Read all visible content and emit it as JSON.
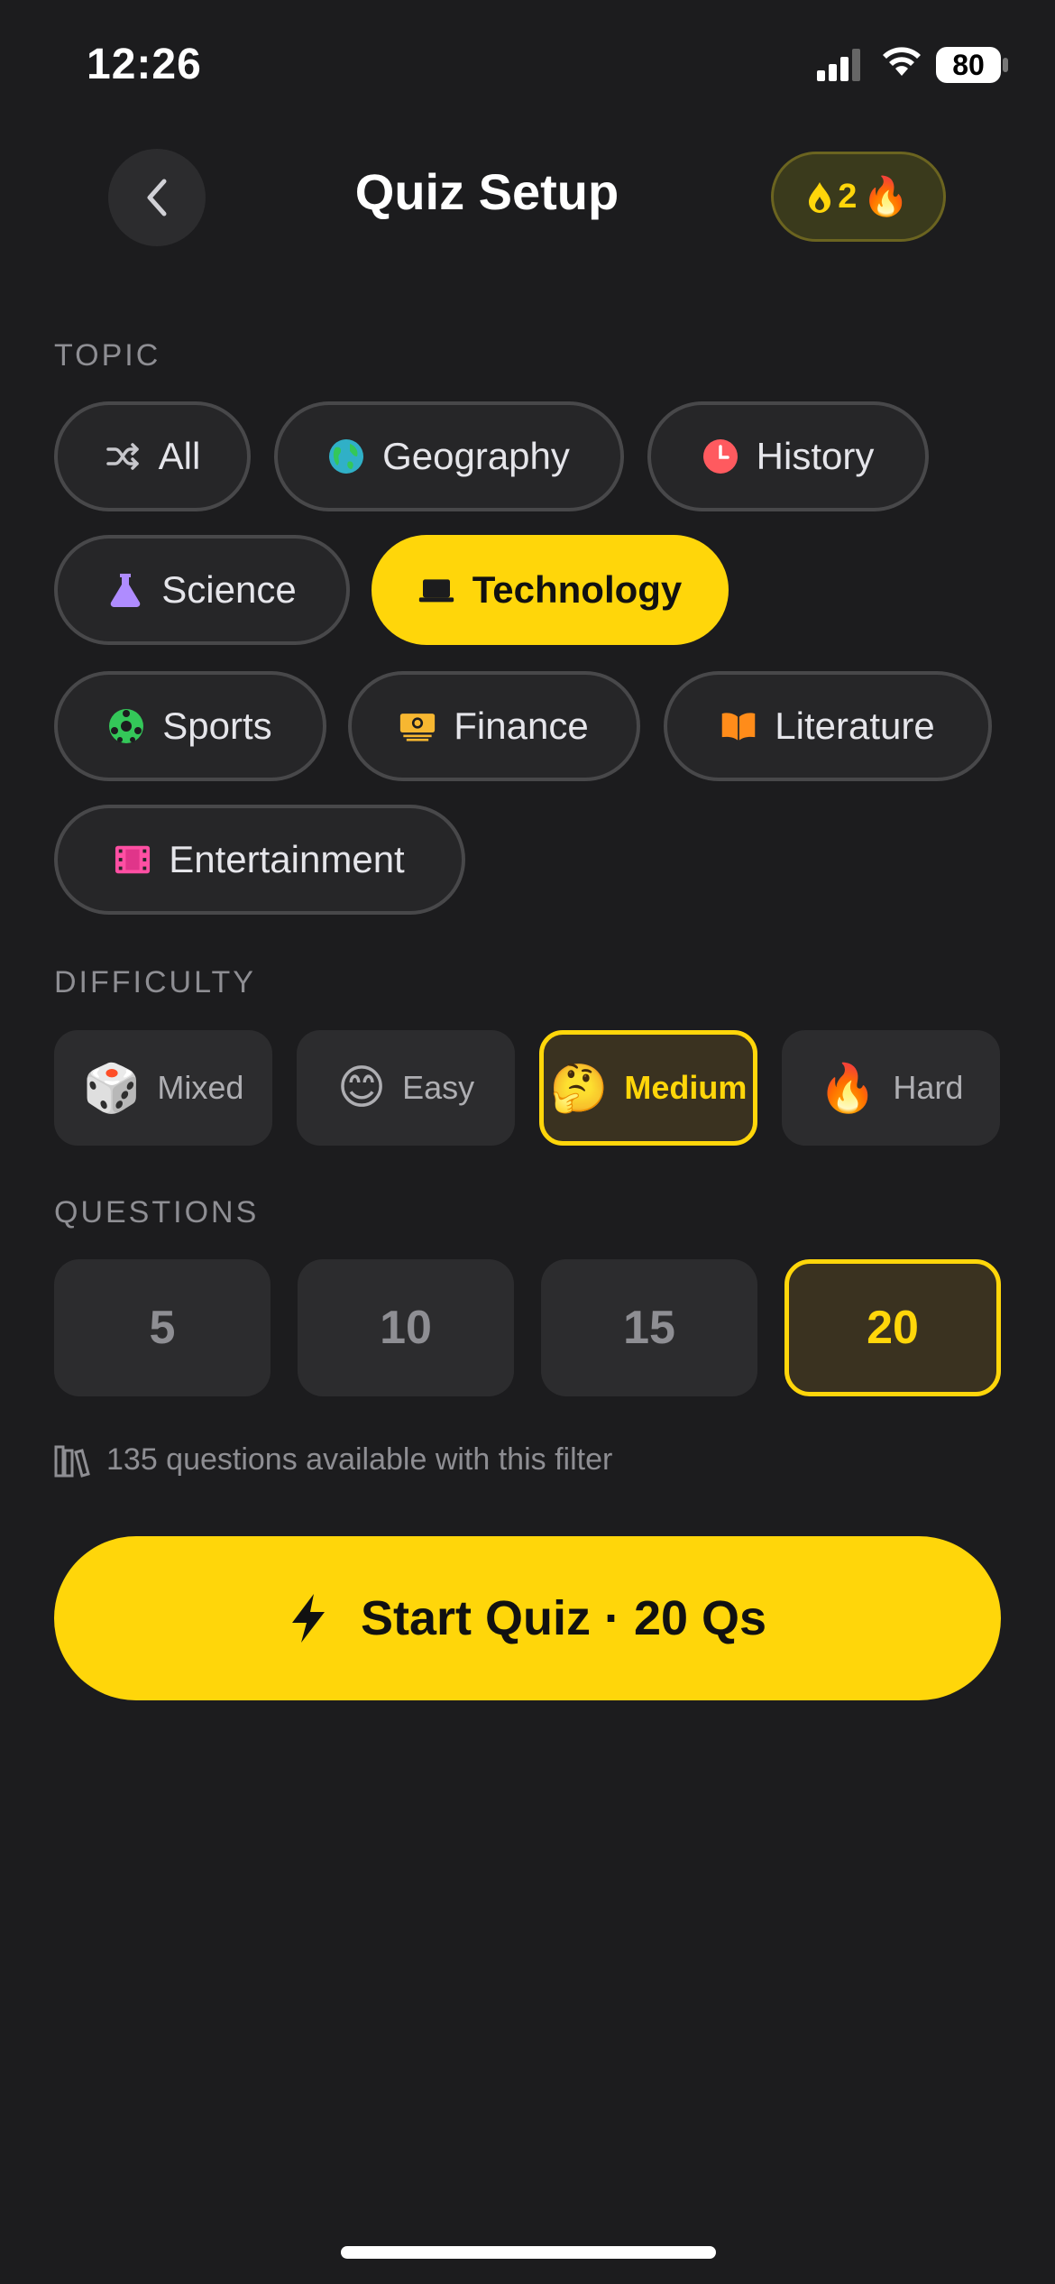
{
  "status": {
    "time": "12:26",
    "battery": "80"
  },
  "header": {
    "title": "Quiz Setup",
    "streak_count": "2",
    "streak_emoji": "🔥"
  },
  "topic": {
    "label": "TOPIC",
    "chips": [
      {
        "label": "All",
        "icon": "shuffle-icon",
        "selected": false
      },
      {
        "label": "Geography",
        "icon": "globe-icon",
        "selected": false
      },
      {
        "label": "History",
        "icon": "clock-icon",
        "selected": false
      },
      {
        "label": "Science",
        "icon": "flask-icon",
        "selected": false
      },
      {
        "label": "Technology",
        "icon": "laptop-icon",
        "selected": true
      },
      {
        "label": "Sports",
        "icon": "soccer-ball-icon",
        "selected": false
      },
      {
        "label": "Finance",
        "icon": "money-icon",
        "selected": false
      },
      {
        "label": "Literature",
        "icon": "book-icon",
        "selected": false
      },
      {
        "label": "Entertainment",
        "icon": "film-icon",
        "selected": false
      }
    ]
  },
  "difficulty": {
    "label": "DIFFICULTY",
    "options": [
      {
        "label": "Mixed",
        "emoji": "🎲",
        "selected": false
      },
      {
        "label": "Easy",
        "emoji": "😊",
        "selected": false
      },
      {
        "label": "Medium",
        "emoji": "🤔",
        "selected": true
      },
      {
        "label": "Hard",
        "emoji": "🔥",
        "selected": false
      }
    ]
  },
  "questions": {
    "label": "QUESTIONS",
    "options": [
      "5",
      "10",
      "15",
      "20"
    ],
    "selected": "20"
  },
  "available_text": "135 questions available with this filter",
  "start_button": {
    "label": "Start Quiz · 20 Qs"
  },
  "colors": {
    "accent": "#ffd60a",
    "background": "#1c1c1e",
    "surface": "#2c2c2e"
  }
}
